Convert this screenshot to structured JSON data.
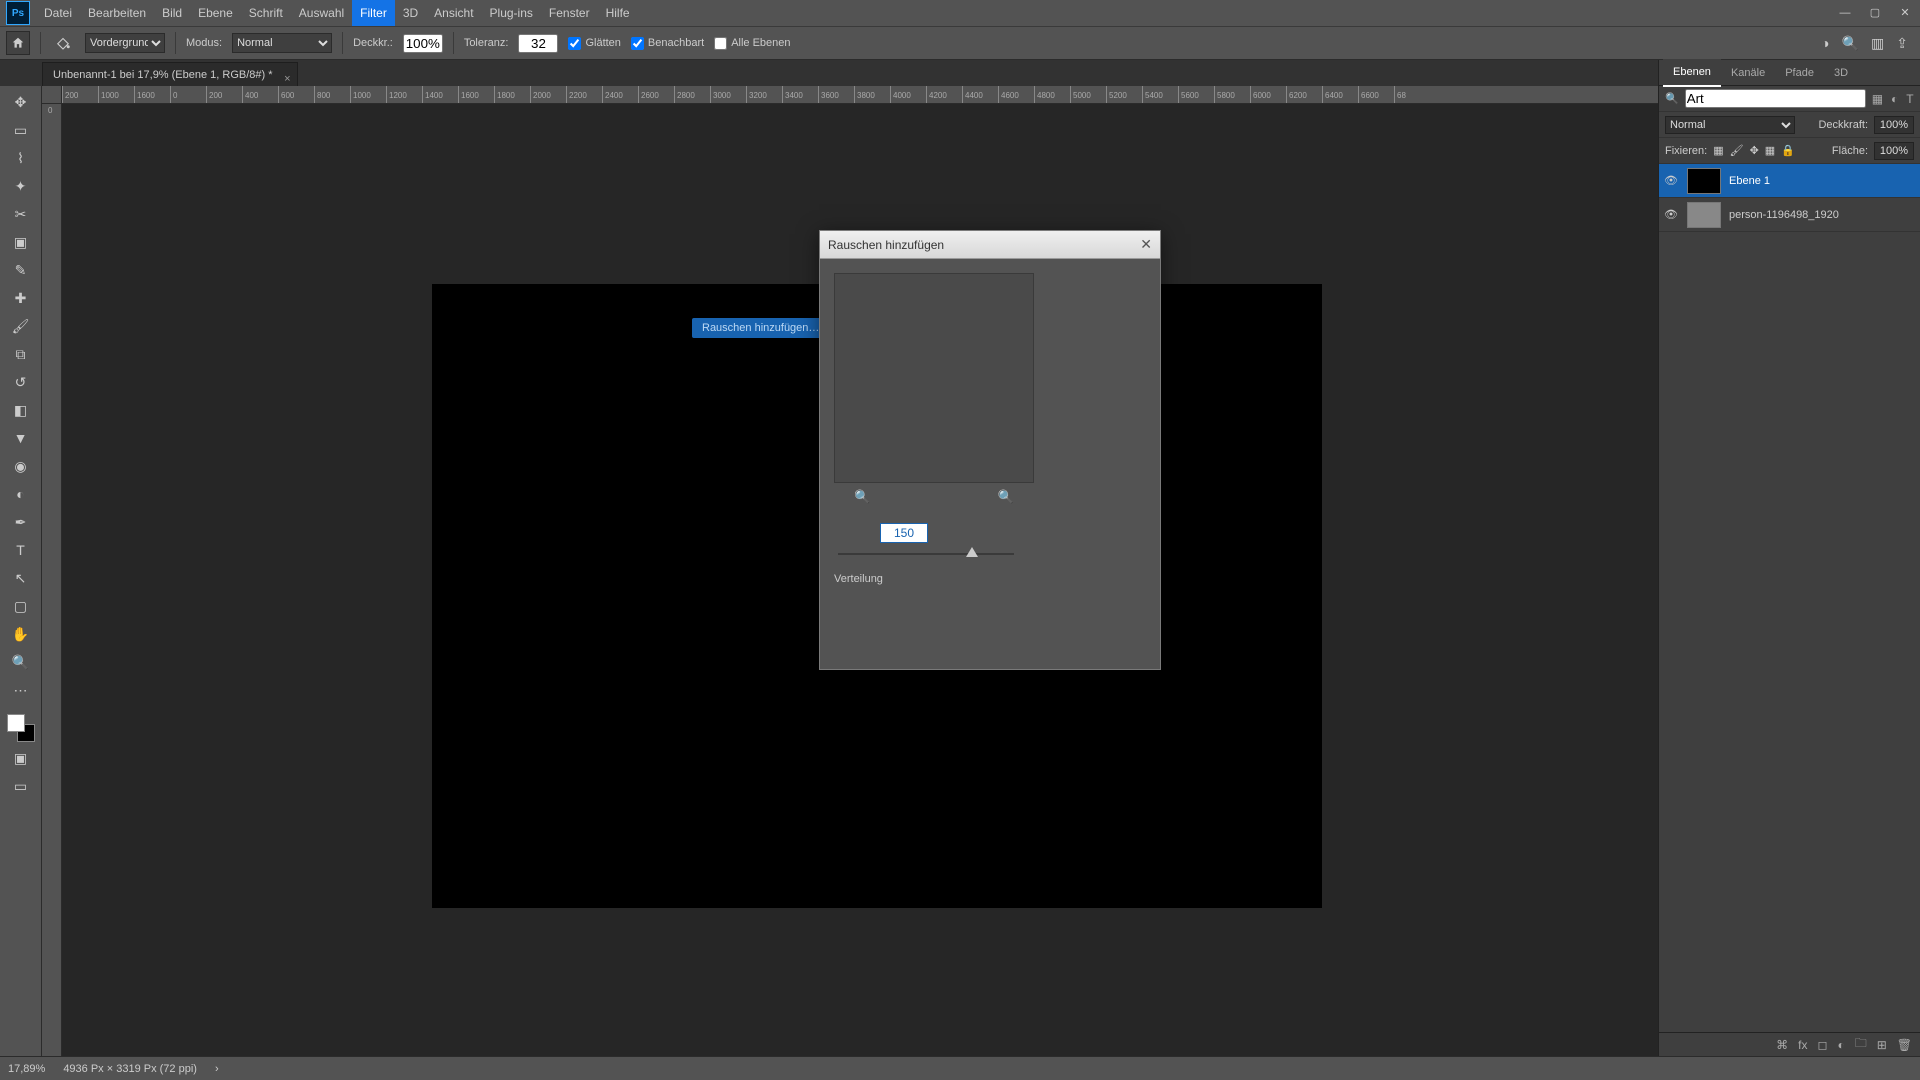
{
  "app": {
    "logo_text": "Ps"
  },
  "menu": {
    "items": [
      "Datei",
      "Bearbeiten",
      "Bild",
      "Ebene",
      "Schrift",
      "Auswahl",
      "Filter",
      "3D",
      "Ansicht",
      "Plug-ins",
      "Fenster",
      "Hilfe"
    ],
    "active_index": 6
  },
  "win_ctrls": {
    "min": "—",
    "max": "▢",
    "close": "✕"
  },
  "options": {
    "foreground_label": "Vordergrund",
    "mode_label": "Modus:",
    "mode_value": "Normal",
    "opacity_label": "Deckkr.:",
    "opacity_value": "100%",
    "tolerance_label": "Toleranz:",
    "tolerance_value": "32",
    "antialias": "Glätten",
    "contiguous": "Benachbart",
    "all_layers": "Alle Ebenen"
  },
  "document": {
    "tab_title": "Unbenannt-1 bei 17,9% (Ebene 1, RGB/8#) *"
  },
  "ruler": {
    "marks": [
      "200",
      "1000",
      "1600",
      "0",
      "200",
      "400",
      "600",
      "800",
      "1000",
      "1200",
      "1400",
      "1600",
      "1800",
      "2000",
      "2200",
      "2400",
      "2600",
      "2800",
      "3000",
      "3200",
      "3400",
      "3600",
      "3800",
      "4000",
      "4200",
      "4400",
      "4600",
      "4800",
      "5000",
      "5200",
      "5400",
      "5600",
      "5800",
      "6000",
      "6200",
      "6400",
      "6600",
      "68"
    ]
  },
  "tooltip": {
    "text": "Rauschen hinzufügen…"
  },
  "dialog": {
    "title": "Rauschen hinzufügen",
    "amount_value": "150",
    "distribution_label": "Verteilung"
  },
  "panels": {
    "tabs": [
      "Ebenen",
      "Kanäle",
      "Pfade",
      "3D"
    ],
    "active_tab": 0,
    "search_placeholder": "Art",
    "blend_mode": "Normal",
    "opacity_label": "Deckkraft:",
    "opacity_value": "100%",
    "lock_label": "Fixieren:",
    "fill_label": "Fläche:",
    "fill_value": "100%",
    "layers": [
      {
        "name": "Ebene 1",
        "selected": true,
        "thumb": "black"
      },
      {
        "name": "person-1196498_1920",
        "selected": false,
        "thumb": "img"
      }
    ]
  },
  "status": {
    "zoom": "17,89%",
    "dims": "4936 Px × 3319 Px (72 ppi)"
  }
}
